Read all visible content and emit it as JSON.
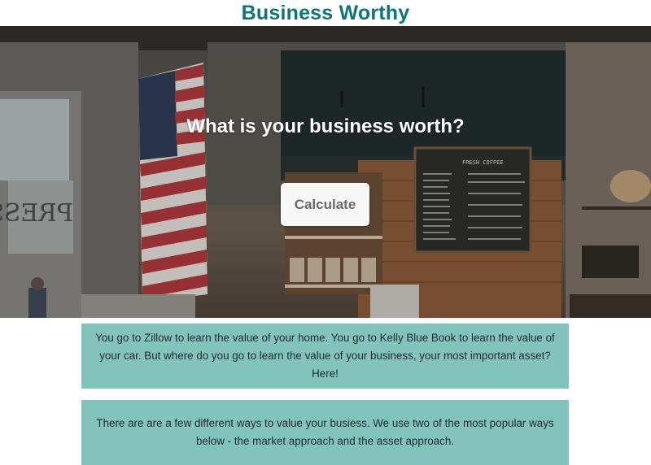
{
  "header": {
    "title": "Business Worthy"
  },
  "hero": {
    "heading": "What is your business worth?",
    "calculate_label": "Calculate",
    "menu_board_title": "FRESH COFFEE",
    "window_sign": "PRESS"
  },
  "info": [
    "You go to Zillow to learn the value of your home. You go to Kelly Blue Book to learn the value of your car. But where do you go to learn the value of your business, your most important asset? Here!",
    "There are are a few different ways to value your busiess. We use two of the most popular ways below - the market approach and the asset approach."
  ],
  "colors": {
    "brand": "#0f7378",
    "info_box": "#82c3bc",
    "button_bg": "#f7f7f7"
  }
}
